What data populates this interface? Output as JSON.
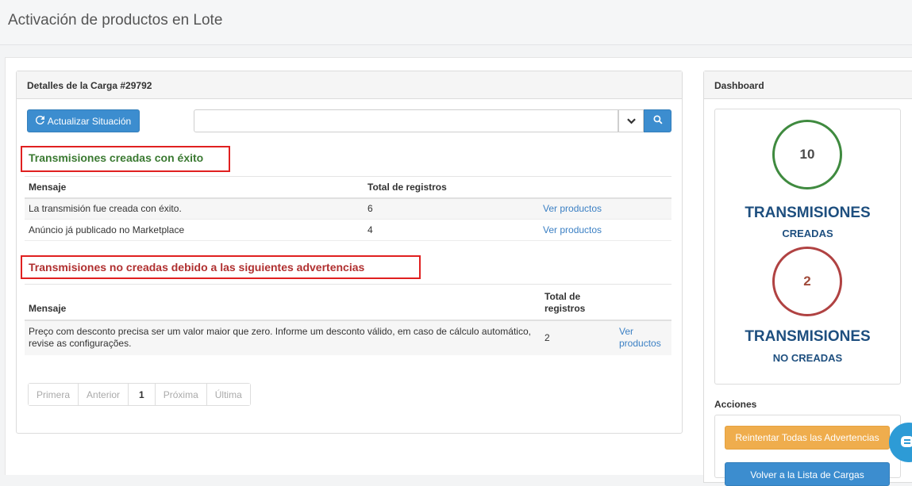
{
  "page": {
    "title": "Activación de productos en Lote"
  },
  "details_panel": {
    "heading": "Detalles de la Carga #29792",
    "refresh_label": "Actualizar Situación",
    "search": {
      "value": "",
      "placeholder": ""
    }
  },
  "success_section": {
    "title": "Transmisiones creadas con éxito",
    "columns": [
      "Mensaje",
      "Total de registros",
      ""
    ],
    "rows": [
      {
        "message": "La transmisión fue creada con éxito.",
        "total": "6",
        "action": "Ver productos"
      },
      {
        "message": "Anúncio já publicado no Marketplace",
        "total": "4",
        "action": "Ver productos"
      }
    ]
  },
  "warning_section": {
    "title": "Transmisiones no creadas debido a las siguientes advertencias",
    "columns": [
      "Mensaje",
      "Total de registros",
      ""
    ],
    "rows": [
      {
        "message": "Preço com desconto precisa ser um valor maior que zero. Informe um desconto válido, em caso de cálculo automático, revise as configurações.",
        "total": "2",
        "action": "Ver productos"
      }
    ]
  },
  "pagination": {
    "first": "Primera",
    "prev": "Anterior",
    "current": "1",
    "next": "Próxima",
    "last": "Última"
  },
  "dashboard": {
    "heading": "Dashboard",
    "created": {
      "count": "10",
      "label_big": "TRANSMISIONES",
      "label_small": "CREADAS",
      "color": "#3f8a3f"
    },
    "not_created": {
      "count": "2",
      "label_big": "TRANSMISIONES",
      "label_small": "NO CREADAS",
      "color": "#b04242"
    }
  },
  "actions": {
    "heading": "Acciones",
    "retry_label": "Reintentar Todas las Advertencias",
    "back_label": "Volver a la Lista de Cargas"
  },
  "icons": {
    "refresh": "refresh-icon",
    "caret": "chevron-down-icon",
    "search": "search-icon",
    "chat": "chat-icon"
  },
  "colors": {
    "primary": "#3c8dcf",
    "warning_button": "#efad4d",
    "success_text": "#3b7a32",
    "danger_text": "#b03030",
    "highlight_border": "#e02020",
    "dashboard_text": "#1e4f7f"
  }
}
